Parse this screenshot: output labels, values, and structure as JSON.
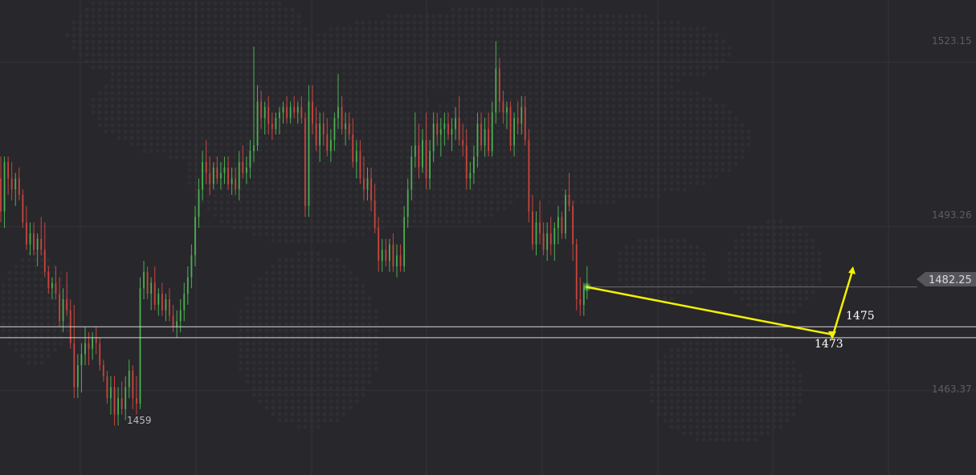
{
  "chart_data": {
    "type": "candlestick",
    "title": "",
    "xlabel": "",
    "ylabel": "",
    "ylim": [
      1448.0,
      1534.5
    ],
    "y_ticks": [
      {
        "value": 1523.15,
        "label": "1523.15"
      },
      {
        "value": 1493.26,
        "label": "1493.26"
      },
      {
        "value": 1463.37,
        "label": "1463.37"
      }
    ],
    "grid": true,
    "current_price": {
      "value": 1482.25,
      "label": "1482.25"
    },
    "support_lines": [
      1475.0,
      1473.0
    ],
    "annotations": [
      {
        "label": "1459",
        "value": 1459.0
      },
      {
        "label": "1475",
        "value": 1475.0
      },
      {
        "label": "1473",
        "value": 1473.0
      }
    ],
    "forecast_arrow": {
      "from": 1482.25,
      "down_to": 1473.0,
      "up_to": 1486.0
    },
    "colors": {
      "background": "#27272c",
      "up": "#4caf50",
      "down": "#c9463d",
      "arrow": "#f4f000",
      "grid": "#333339",
      "support_line": "#d8d8d8",
      "price_tag": "#55555b"
    },
    "candles": [
      {
        "o": 1502,
        "h": 1506,
        "l": 1494,
        "c": 1496
      },
      {
        "o": 1496,
        "h": 1506,
        "l": 1493,
        "c": 1505
      },
      {
        "o": 1505,
        "h": 1506,
        "l": 1499,
        "c": 1502
      },
      {
        "o": 1502,
        "h": 1505,
        "l": 1498,
        "c": 1500
      },
      {
        "o": 1500,
        "h": 1503,
        "l": 1497,
        "c": 1502
      },
      {
        "o": 1502,
        "h": 1504,
        "l": 1498,
        "c": 1499
      },
      {
        "o": 1499,
        "h": 1500,
        "l": 1493,
        "c": 1494
      },
      {
        "o": 1494,
        "h": 1497,
        "l": 1489,
        "c": 1490
      },
      {
        "o": 1490,
        "h": 1494,
        "l": 1488,
        "c": 1492
      },
      {
        "o": 1492,
        "h": 1494,
        "l": 1488,
        "c": 1489
      },
      {
        "o": 1489,
        "h": 1492,
        "l": 1486,
        "c": 1491
      },
      {
        "o": 1491,
        "h": 1495,
        "l": 1488,
        "c": 1489
      },
      {
        "o": 1489,
        "h": 1494,
        "l": 1484,
        "c": 1485
      },
      {
        "o": 1485,
        "h": 1486,
        "l": 1481,
        "c": 1482
      },
      {
        "o": 1482,
        "h": 1484,
        "l": 1480,
        "c": 1483
      },
      {
        "o": 1483,
        "h": 1486,
        "l": 1480,
        "c": 1481
      },
      {
        "o": 1481,
        "h": 1484,
        "l": 1475,
        "c": 1476
      },
      {
        "o": 1476,
        "h": 1482,
        "l": 1474,
        "c": 1480
      },
      {
        "o": 1480,
        "h": 1485,
        "l": 1477,
        "c": 1478
      },
      {
        "o": 1478,
        "h": 1480,
        "l": 1471,
        "c": 1472
      },
      {
        "o": 1472,
        "h": 1479,
        "l": 1462,
        "c": 1464
      },
      {
        "o": 1464,
        "h": 1470,
        "l": 1462,
        "c": 1468
      },
      {
        "o": 1468,
        "h": 1472,
        "l": 1463,
        "c": 1470
      },
      {
        "o": 1470,
        "h": 1475,
        "l": 1468,
        "c": 1472
      },
      {
        "o": 1472,
        "h": 1474,
        "l": 1468,
        "c": 1471
      },
      {
        "o": 1471,
        "h": 1474,
        "l": 1469,
        "c": 1473
      },
      {
        "o": 1473,
        "h": 1475,
        "l": 1470,
        "c": 1472
      },
      {
        "o": 1472,
        "h": 1473,
        "l": 1467,
        "c": 1468
      },
      {
        "o": 1468,
        "h": 1469,
        "l": 1465,
        "c": 1466
      },
      {
        "o": 1466,
        "h": 1467,
        "l": 1461,
        "c": 1462
      },
      {
        "o": 1462,
        "h": 1466,
        "l": 1459,
        "c": 1464
      },
      {
        "o": 1464,
        "h": 1466,
        "l": 1457,
        "c": 1459
      },
      {
        "o": 1459,
        "h": 1464,
        "l": 1457,
        "c": 1462
      },
      {
        "o": 1462,
        "h": 1465,
        "l": 1459,
        "c": 1460
      },
      {
        "o": 1460,
        "h": 1466,
        "l": 1458,
        "c": 1464
      },
      {
        "o": 1464,
        "h": 1469,
        "l": 1462,
        "c": 1467
      },
      {
        "o": 1467,
        "h": 1468,
        "l": 1460,
        "c": 1462
      },
      {
        "o": 1462,
        "h": 1466,
        "l": 1459,
        "c": 1461
      },
      {
        "o": 1461,
        "h": 1484,
        "l": 1460,
        "c": 1482
      },
      {
        "o": 1482,
        "h": 1487,
        "l": 1480,
        "c": 1485
      },
      {
        "o": 1485,
        "h": 1486,
        "l": 1480,
        "c": 1481
      },
      {
        "o": 1481,
        "h": 1484,
        "l": 1478,
        "c": 1483
      },
      {
        "o": 1483,
        "h": 1486,
        "l": 1478,
        "c": 1479
      },
      {
        "o": 1479,
        "h": 1482,
        "l": 1477,
        "c": 1481
      },
      {
        "o": 1481,
        "h": 1483,
        "l": 1477,
        "c": 1478
      },
      {
        "o": 1478,
        "h": 1481,
        "l": 1476,
        "c": 1480
      },
      {
        "o": 1480,
        "h": 1482,
        "l": 1476,
        "c": 1477
      },
      {
        "o": 1477,
        "h": 1479,
        "l": 1474,
        "c": 1475
      },
      {
        "o": 1475,
        "h": 1478,
        "l": 1473,
        "c": 1476
      },
      {
        "o": 1476,
        "h": 1480,
        "l": 1474,
        "c": 1478
      },
      {
        "o": 1478,
        "h": 1483,
        "l": 1476,
        "c": 1481
      },
      {
        "o": 1481,
        "h": 1486,
        "l": 1479,
        "c": 1484
      },
      {
        "o": 1484,
        "h": 1490,
        "l": 1482,
        "c": 1488
      },
      {
        "o": 1488,
        "h": 1497,
        "l": 1486,
        "c": 1495
      },
      {
        "o": 1495,
        "h": 1502,
        "l": 1493,
        "c": 1500
      },
      {
        "o": 1500,
        "h": 1507,
        "l": 1498,
        "c": 1505
      },
      {
        "o": 1505,
        "h": 1509,
        "l": 1501,
        "c": 1503
      },
      {
        "o": 1503,
        "h": 1506,
        "l": 1499,
        "c": 1501
      },
      {
        "o": 1501,
        "h": 1505,
        "l": 1500,
        "c": 1504
      },
      {
        "o": 1504,
        "h": 1506,
        "l": 1501,
        "c": 1502
      },
      {
        "o": 1502,
        "h": 1505,
        "l": 1500,
        "c": 1503
      },
      {
        "o": 1503,
        "h": 1506,
        "l": 1501,
        "c": 1504
      },
      {
        "o": 1504,
        "h": 1506,
        "l": 1500,
        "c": 1501
      },
      {
        "o": 1501,
        "h": 1504,
        "l": 1499,
        "c": 1502
      },
      {
        "o": 1502,
        "h": 1504,
        "l": 1499,
        "c": 1500
      },
      {
        "o": 1500,
        "h": 1507,
        "l": 1498,
        "c": 1505
      },
      {
        "o": 1505,
        "h": 1508,
        "l": 1502,
        "c": 1503
      },
      {
        "o": 1503,
        "h": 1506,
        "l": 1501,
        "c": 1504
      },
      {
        "o": 1504,
        "h": 1509,
        "l": 1502,
        "c": 1507
      },
      {
        "o": 1507,
        "h": 1526,
        "l": 1505,
        "c": 1508
      },
      {
        "o": 1508,
        "h": 1519,
        "l": 1507,
        "c": 1516
      },
      {
        "o": 1516,
        "h": 1518,
        "l": 1511,
        "c": 1513
      },
      {
        "o": 1513,
        "h": 1516,
        "l": 1510,
        "c": 1515
      },
      {
        "o": 1515,
        "h": 1517,
        "l": 1510,
        "c": 1512
      },
      {
        "o": 1512,
        "h": 1514,
        "l": 1509,
        "c": 1511
      },
      {
        "o": 1511,
        "h": 1514,
        "l": 1510,
        "c": 1513
      },
      {
        "o": 1513,
        "h": 1515,
        "l": 1510,
        "c": 1514
      },
      {
        "o": 1514,
        "h": 1516,
        "l": 1512,
        "c": 1515
      },
      {
        "o": 1515,
        "h": 1517,
        "l": 1512,
        "c": 1513
      },
      {
        "o": 1513,
        "h": 1516,
        "l": 1512,
        "c": 1515
      },
      {
        "o": 1515,
        "h": 1517,
        "l": 1513,
        "c": 1514
      },
      {
        "o": 1514,
        "h": 1516,
        "l": 1512,
        "c": 1515
      },
      {
        "o": 1515,
        "h": 1517,
        "l": 1512,
        "c": 1513
      },
      {
        "o": 1513,
        "h": 1514,
        "l": 1495,
        "c": 1497
      },
      {
        "o": 1497,
        "h": 1519,
        "l": 1495,
        "c": 1516
      },
      {
        "o": 1516,
        "h": 1519,
        "l": 1510,
        "c": 1512
      },
      {
        "o": 1512,
        "h": 1515,
        "l": 1507,
        "c": 1508
      },
      {
        "o": 1508,
        "h": 1514,
        "l": 1505,
        "c": 1512
      },
      {
        "o": 1512,
        "h": 1514,
        "l": 1508,
        "c": 1510
      },
      {
        "o": 1510,
        "h": 1513,
        "l": 1506,
        "c": 1507
      },
      {
        "o": 1507,
        "h": 1511,
        "l": 1505,
        "c": 1509
      },
      {
        "o": 1509,
        "h": 1514,
        "l": 1507,
        "c": 1513
      },
      {
        "o": 1513,
        "h": 1521,
        "l": 1511,
        "c": 1515
      },
      {
        "o": 1515,
        "h": 1517,
        "l": 1510,
        "c": 1511
      },
      {
        "o": 1511,
        "h": 1514,
        "l": 1508,
        "c": 1512
      },
      {
        "o": 1512,
        "h": 1514,
        "l": 1509,
        "c": 1510
      },
      {
        "o": 1510,
        "h": 1513,
        "l": 1504,
        "c": 1505
      },
      {
        "o": 1505,
        "h": 1509,
        "l": 1502,
        "c": 1507
      },
      {
        "o": 1507,
        "h": 1509,
        "l": 1501,
        "c": 1502
      },
      {
        "o": 1502,
        "h": 1506,
        "l": 1498,
        "c": 1500
      },
      {
        "o": 1500,
        "h": 1504,
        "l": 1498,
        "c": 1502
      },
      {
        "o": 1502,
        "h": 1504,
        "l": 1496,
        "c": 1498
      },
      {
        "o": 1498,
        "h": 1501,
        "l": 1492,
        "c": 1493
      },
      {
        "o": 1493,
        "h": 1495,
        "l": 1485,
        "c": 1487
      },
      {
        "o": 1487,
        "h": 1491,
        "l": 1485,
        "c": 1489
      },
      {
        "o": 1489,
        "h": 1491,
        "l": 1486,
        "c": 1487
      },
      {
        "o": 1487,
        "h": 1491,
        "l": 1485,
        "c": 1490
      },
      {
        "o": 1490,
        "h": 1492,
        "l": 1485,
        "c": 1486
      },
      {
        "o": 1486,
        "h": 1490,
        "l": 1484,
        "c": 1488
      },
      {
        "o": 1488,
        "h": 1490,
        "l": 1485,
        "c": 1486
      },
      {
        "o": 1486,
        "h": 1497,
        "l": 1485,
        "c": 1495
      },
      {
        "o": 1495,
        "h": 1502,
        "l": 1493,
        "c": 1500
      },
      {
        "o": 1500,
        "h": 1508,
        "l": 1498,
        "c": 1506
      },
      {
        "o": 1506,
        "h": 1514,
        "l": 1504,
        "c": 1508
      },
      {
        "o": 1508,
        "h": 1512,
        "l": 1502,
        "c": 1504
      },
      {
        "o": 1504,
        "h": 1511,
        "l": 1503,
        "c": 1509
      },
      {
        "o": 1509,
        "h": 1514,
        "l": 1500,
        "c": 1502
      },
      {
        "o": 1502,
        "h": 1509,
        "l": 1500,
        "c": 1507
      },
      {
        "o": 1507,
        "h": 1514,
        "l": 1505,
        "c": 1512
      },
      {
        "o": 1512,
        "h": 1514,
        "l": 1508,
        "c": 1510
      },
      {
        "o": 1510,
        "h": 1513,
        "l": 1506,
        "c": 1511
      },
      {
        "o": 1511,
        "h": 1514,
        "l": 1508,
        "c": 1512
      },
      {
        "o": 1512,
        "h": 1514,
        "l": 1509,
        "c": 1510
      },
      {
        "o": 1510,
        "h": 1513,
        "l": 1507,
        "c": 1511
      },
      {
        "o": 1511,
        "h": 1515,
        "l": 1509,
        "c": 1513
      },
      {
        "o": 1513,
        "h": 1517,
        "l": 1508,
        "c": 1509
      },
      {
        "o": 1509,
        "h": 1512,
        "l": 1506,
        "c": 1508
      },
      {
        "o": 1508,
        "h": 1511,
        "l": 1500,
        "c": 1502
      },
      {
        "o": 1502,
        "h": 1505,
        "l": 1500,
        "c": 1503
      },
      {
        "o": 1503,
        "h": 1508,
        "l": 1501,
        "c": 1506
      },
      {
        "o": 1506,
        "h": 1514,
        "l": 1504,
        "c": 1512
      },
      {
        "o": 1512,
        "h": 1514,
        "l": 1507,
        "c": 1508
      },
      {
        "o": 1508,
        "h": 1513,
        "l": 1506,
        "c": 1511
      },
      {
        "o": 1511,
        "h": 1514,
        "l": 1506,
        "c": 1507
      },
      {
        "o": 1507,
        "h": 1516,
        "l": 1506,
        "c": 1514
      },
      {
        "o": 1514,
        "h": 1527,
        "l": 1512,
        "c": 1522
      },
      {
        "o": 1522,
        "h": 1524,
        "l": 1514,
        "c": 1516
      },
      {
        "o": 1516,
        "h": 1518,
        "l": 1512,
        "c": 1514
      },
      {
        "o": 1514,
        "h": 1516,
        "l": 1511,
        "c": 1515
      },
      {
        "o": 1515,
        "h": 1516,
        "l": 1507,
        "c": 1508
      },
      {
        "o": 1508,
        "h": 1514,
        "l": 1506,
        "c": 1513
      },
      {
        "o": 1513,
        "h": 1516,
        "l": 1510,
        "c": 1512
      },
      {
        "o": 1512,
        "h": 1517,
        "l": 1510,
        "c": 1515
      },
      {
        "o": 1515,
        "h": 1517,
        "l": 1508,
        "c": 1509
      },
      {
        "o": 1509,
        "h": 1511,
        "l": 1494,
        "c": 1496
      },
      {
        "o": 1496,
        "h": 1499,
        "l": 1489,
        "c": 1490
      },
      {
        "o": 1490,
        "h": 1496,
        "l": 1488,
        "c": 1494
      },
      {
        "o": 1494,
        "h": 1498,
        "l": 1490,
        "c": 1492
      },
      {
        "o": 1492,
        "h": 1494,
        "l": 1488,
        "c": 1489
      },
      {
        "o": 1489,
        "h": 1494,
        "l": 1487,
        "c": 1492
      },
      {
        "o": 1492,
        "h": 1495,
        "l": 1488,
        "c": 1490
      },
      {
        "o": 1490,
        "h": 1494,
        "l": 1487,
        "c": 1493
      },
      {
        "o": 1493,
        "h": 1497,
        "l": 1490,
        "c": 1495
      },
      {
        "o": 1495,
        "h": 1496,
        "l": 1491,
        "c": 1492
      },
      {
        "o": 1492,
        "h": 1500,
        "l": 1491,
        "c": 1499
      },
      {
        "o": 1499,
        "h": 1503,
        "l": 1496,
        "c": 1497
      },
      {
        "o": 1497,
        "h": 1498,
        "l": 1487,
        "c": 1490
      },
      {
        "o": 1490,
        "h": 1491,
        "l": 1478,
        "c": 1480
      },
      {
        "o": 1480,
        "h": 1484,
        "l": 1477,
        "c": 1479
      },
      {
        "o": 1479,
        "h": 1483,
        "l": 1477,
        "c": 1482
      }
    ]
  },
  "labels": {
    "tick_1": "1523.15",
    "tick_2": "1493.26",
    "tick_3": "1463.37",
    "price_tag": "1482.25",
    "low_label": "1459",
    "level_1475": "1475",
    "level_1473": "1473"
  }
}
